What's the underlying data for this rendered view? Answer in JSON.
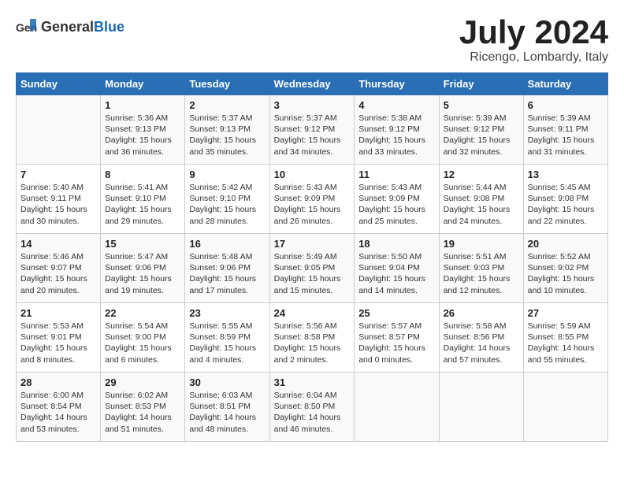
{
  "header": {
    "logo_general": "General",
    "logo_blue": "Blue",
    "month_title": "July 2024",
    "location": "Ricengo, Lombardy, Italy"
  },
  "calendar": {
    "days_of_week": [
      "Sunday",
      "Monday",
      "Tuesday",
      "Wednesday",
      "Thursday",
      "Friday",
      "Saturday"
    ],
    "weeks": [
      [
        {
          "day": "",
          "lines": []
        },
        {
          "day": "1",
          "lines": [
            "Sunrise: 5:36 AM",
            "Sunset: 9:13 PM",
            "Daylight: 15 hours",
            "and 36 minutes."
          ]
        },
        {
          "day": "2",
          "lines": [
            "Sunrise: 5:37 AM",
            "Sunset: 9:13 PM",
            "Daylight: 15 hours",
            "and 35 minutes."
          ]
        },
        {
          "day": "3",
          "lines": [
            "Sunrise: 5:37 AM",
            "Sunset: 9:12 PM",
            "Daylight: 15 hours",
            "and 34 minutes."
          ]
        },
        {
          "day": "4",
          "lines": [
            "Sunrise: 5:38 AM",
            "Sunset: 9:12 PM",
            "Daylight: 15 hours",
            "and 33 minutes."
          ]
        },
        {
          "day": "5",
          "lines": [
            "Sunrise: 5:39 AM",
            "Sunset: 9:12 PM",
            "Daylight: 15 hours",
            "and 32 minutes."
          ]
        },
        {
          "day": "6",
          "lines": [
            "Sunrise: 5:39 AM",
            "Sunset: 9:11 PM",
            "Daylight: 15 hours",
            "and 31 minutes."
          ]
        }
      ],
      [
        {
          "day": "7",
          "lines": [
            "Sunrise: 5:40 AM",
            "Sunset: 9:11 PM",
            "Daylight: 15 hours",
            "and 30 minutes."
          ]
        },
        {
          "day": "8",
          "lines": [
            "Sunrise: 5:41 AM",
            "Sunset: 9:10 PM",
            "Daylight: 15 hours",
            "and 29 minutes."
          ]
        },
        {
          "day": "9",
          "lines": [
            "Sunrise: 5:42 AM",
            "Sunset: 9:10 PM",
            "Daylight: 15 hours",
            "and 28 minutes."
          ]
        },
        {
          "day": "10",
          "lines": [
            "Sunrise: 5:43 AM",
            "Sunset: 9:09 PM",
            "Daylight: 15 hours",
            "and 26 minutes."
          ]
        },
        {
          "day": "11",
          "lines": [
            "Sunrise: 5:43 AM",
            "Sunset: 9:09 PM",
            "Daylight: 15 hours",
            "and 25 minutes."
          ]
        },
        {
          "day": "12",
          "lines": [
            "Sunrise: 5:44 AM",
            "Sunset: 9:08 PM",
            "Daylight: 15 hours",
            "and 24 minutes."
          ]
        },
        {
          "day": "13",
          "lines": [
            "Sunrise: 5:45 AM",
            "Sunset: 9:08 PM",
            "Daylight: 15 hours",
            "and 22 minutes."
          ]
        }
      ],
      [
        {
          "day": "14",
          "lines": [
            "Sunrise: 5:46 AM",
            "Sunset: 9:07 PM",
            "Daylight: 15 hours",
            "and 20 minutes."
          ]
        },
        {
          "day": "15",
          "lines": [
            "Sunrise: 5:47 AM",
            "Sunset: 9:06 PM",
            "Daylight: 15 hours",
            "and 19 minutes."
          ]
        },
        {
          "day": "16",
          "lines": [
            "Sunrise: 5:48 AM",
            "Sunset: 9:06 PM",
            "Daylight: 15 hours",
            "and 17 minutes."
          ]
        },
        {
          "day": "17",
          "lines": [
            "Sunrise: 5:49 AM",
            "Sunset: 9:05 PM",
            "Daylight: 15 hours",
            "and 15 minutes."
          ]
        },
        {
          "day": "18",
          "lines": [
            "Sunrise: 5:50 AM",
            "Sunset: 9:04 PM",
            "Daylight: 15 hours",
            "and 14 minutes."
          ]
        },
        {
          "day": "19",
          "lines": [
            "Sunrise: 5:51 AM",
            "Sunset: 9:03 PM",
            "Daylight: 15 hours",
            "and 12 minutes."
          ]
        },
        {
          "day": "20",
          "lines": [
            "Sunrise: 5:52 AM",
            "Sunset: 9:02 PM",
            "Daylight: 15 hours",
            "and 10 minutes."
          ]
        }
      ],
      [
        {
          "day": "21",
          "lines": [
            "Sunrise: 5:53 AM",
            "Sunset: 9:01 PM",
            "Daylight: 15 hours",
            "and 8 minutes."
          ]
        },
        {
          "day": "22",
          "lines": [
            "Sunrise: 5:54 AM",
            "Sunset: 9:00 PM",
            "Daylight: 15 hours",
            "and 6 minutes."
          ]
        },
        {
          "day": "23",
          "lines": [
            "Sunrise: 5:55 AM",
            "Sunset: 8:59 PM",
            "Daylight: 15 hours",
            "and 4 minutes."
          ]
        },
        {
          "day": "24",
          "lines": [
            "Sunrise: 5:56 AM",
            "Sunset: 8:58 PM",
            "Daylight: 15 hours",
            "and 2 minutes."
          ]
        },
        {
          "day": "25",
          "lines": [
            "Sunrise: 5:57 AM",
            "Sunset: 8:57 PM",
            "Daylight: 15 hours",
            "and 0 minutes."
          ]
        },
        {
          "day": "26",
          "lines": [
            "Sunrise: 5:58 AM",
            "Sunset: 8:56 PM",
            "Daylight: 14 hours",
            "and 57 minutes."
          ]
        },
        {
          "day": "27",
          "lines": [
            "Sunrise: 5:59 AM",
            "Sunset: 8:55 PM",
            "Daylight: 14 hours",
            "and 55 minutes."
          ]
        }
      ],
      [
        {
          "day": "28",
          "lines": [
            "Sunrise: 6:00 AM",
            "Sunset: 8:54 PM",
            "Daylight: 14 hours",
            "and 53 minutes."
          ]
        },
        {
          "day": "29",
          "lines": [
            "Sunrise: 6:02 AM",
            "Sunset: 8:53 PM",
            "Daylight: 14 hours",
            "and 51 minutes."
          ]
        },
        {
          "day": "30",
          "lines": [
            "Sunrise: 6:03 AM",
            "Sunset: 8:51 PM",
            "Daylight: 14 hours",
            "and 48 minutes."
          ]
        },
        {
          "day": "31",
          "lines": [
            "Sunrise: 6:04 AM",
            "Sunset: 8:50 PM",
            "Daylight: 14 hours",
            "and 46 minutes."
          ]
        },
        {
          "day": "",
          "lines": []
        },
        {
          "day": "",
          "lines": []
        },
        {
          "day": "",
          "lines": []
        }
      ]
    ]
  }
}
